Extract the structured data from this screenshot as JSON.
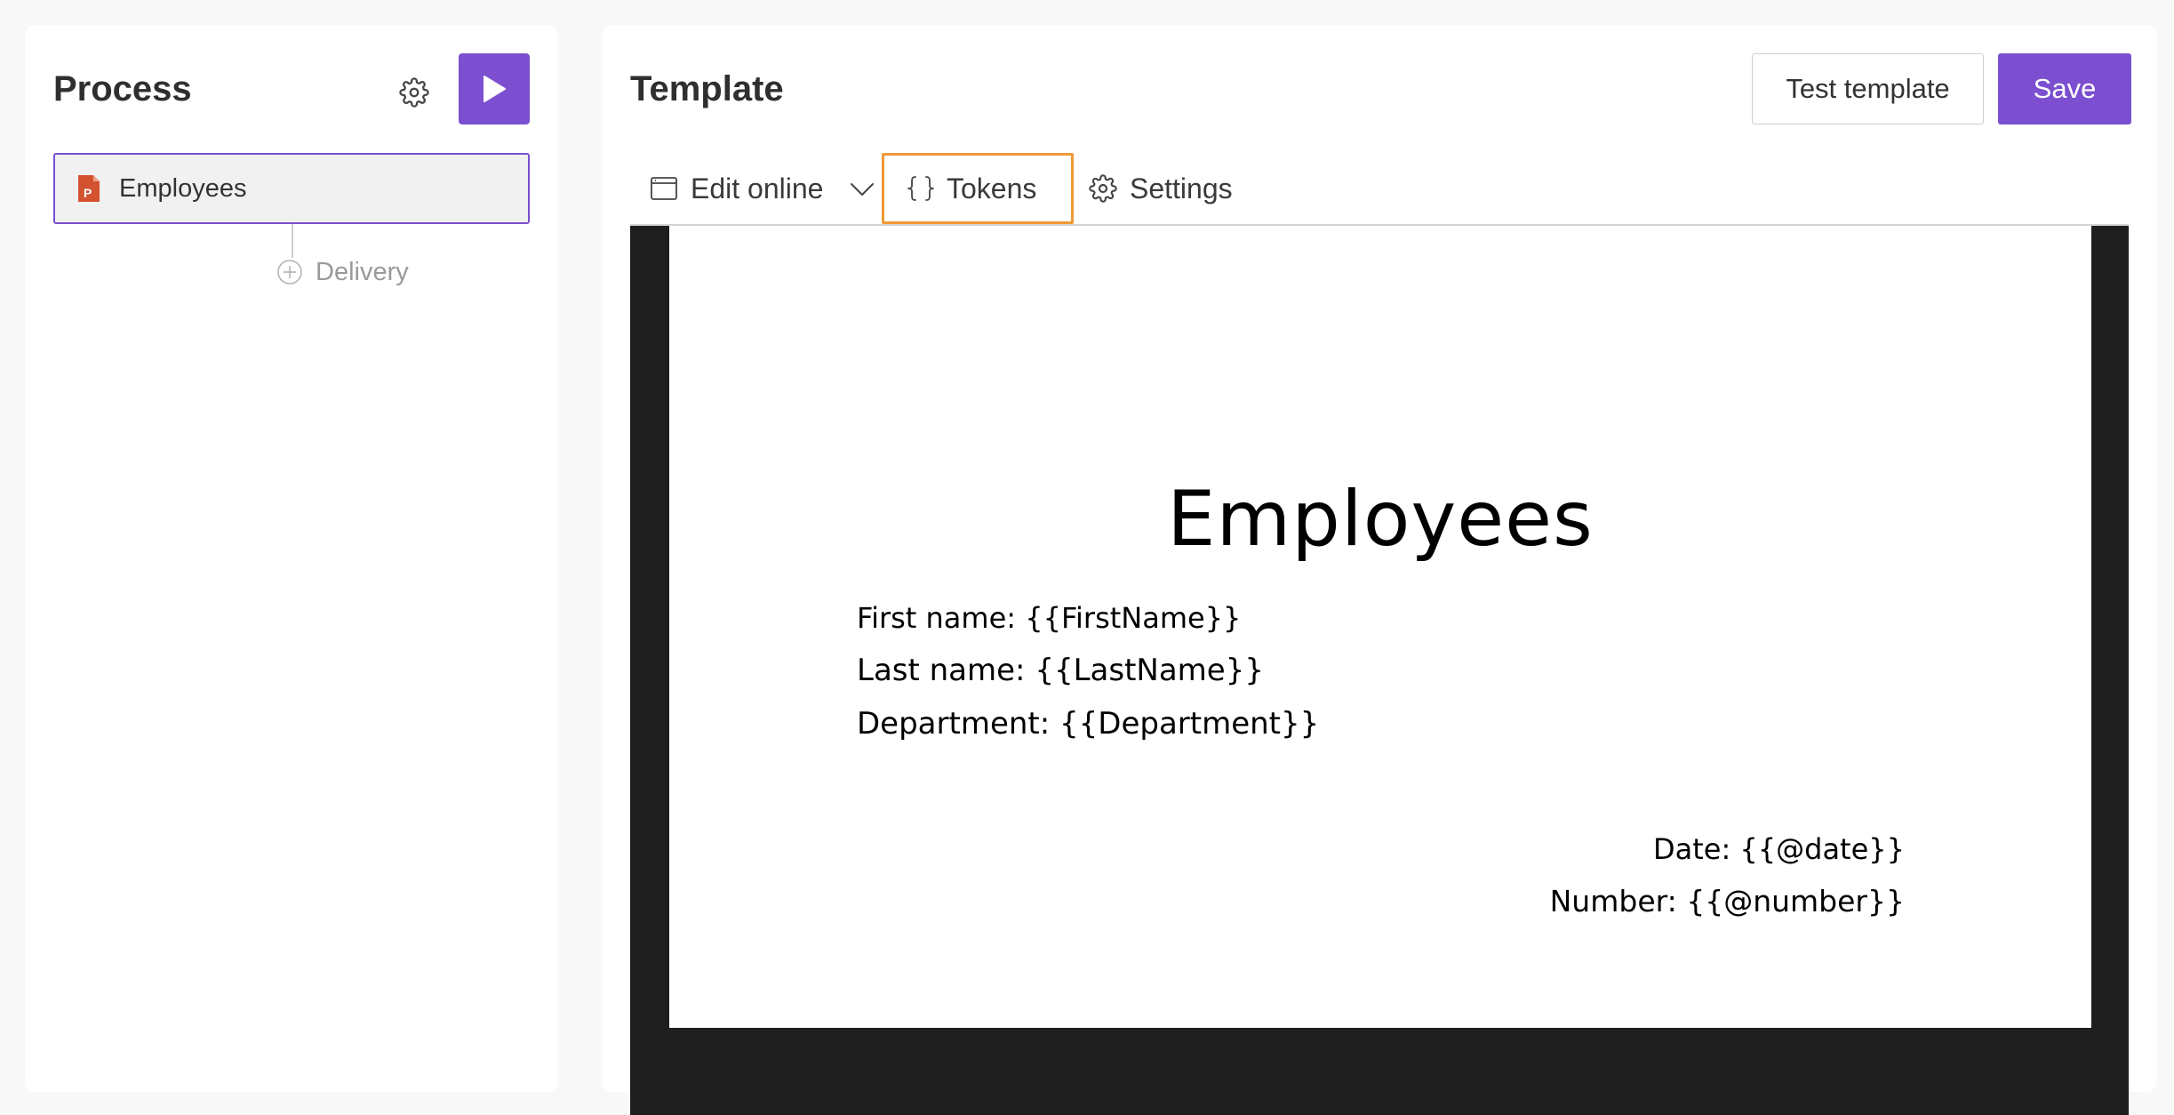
{
  "left_panel": {
    "title": "Process",
    "steps": [
      {
        "label": "Employees",
        "icon": "powerpoint-file-icon"
      }
    ],
    "add_step": {
      "label": "Delivery",
      "icon": "plus-circle-icon"
    }
  },
  "right_panel": {
    "title": "Template",
    "buttons": {
      "test_template": "Test template",
      "save": "Save"
    },
    "tabs": [
      {
        "label": "Edit online",
        "icon": "browser-window-icon"
      },
      {
        "label": "Tokens",
        "icon": "curly-braces-icon",
        "highlighted": true
      },
      {
        "label": "Settings",
        "icon": "gear-icon"
      }
    ]
  },
  "slide": {
    "title": "Employees",
    "lines": [
      "First name: {{FirstName}}",
      "Last name: {{LastName}}",
      "Department: {{Department}}"
    ],
    "footer_lines": [
      "Date: {{@date}}",
      "Number: {{@number}}"
    ]
  },
  "colors": {
    "accent": "#7b4fcf",
    "highlight": "#f09a36",
    "powerpoint": "#d35230",
    "preview_background": "#1e1e1e"
  }
}
